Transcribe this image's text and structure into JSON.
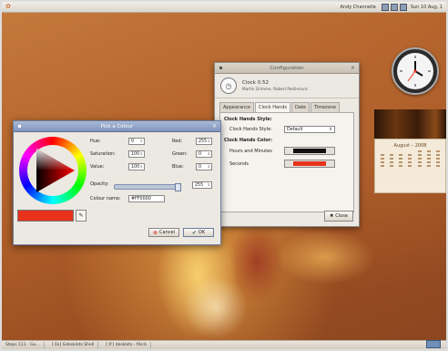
{
  "topbar": {
    "user": "Andy Channelle",
    "time": "Sun 10 Aug, 1"
  },
  "taskbar": {
    "items": [
      "Steps 111 - Gu...",
      "[ 0x] Gdesklets Shell",
      "[ 0'] desklets - file:b"
    ]
  },
  "config": {
    "title": "Configuration",
    "app_name": "Clock 0.52",
    "authors": "Martin Grimme, Robert Pastierovic",
    "tabs": [
      "Appearance",
      "Clock Hands",
      "Date",
      "Timezone"
    ],
    "style_header": "Clock Hands Style:",
    "style_label": "Clock Hands Style:",
    "style_value": "Default",
    "color_header": "Clock Hands Color:",
    "hm_label": "Hours and Minutes",
    "seconds_label": "Seconds",
    "close_label": "Close",
    "hm_color": "#111111",
    "sec_color": "#e8321c"
  },
  "pick": {
    "title": "Pick a Colour",
    "hue_label": "Hue:",
    "hue": "0",
    "sat_label": "Saturation:",
    "sat": "100",
    "val_label": "Value:",
    "val": "100",
    "red_label": "Red:",
    "red": "255",
    "green_label": "Green:",
    "green": "0",
    "blue_label": "Blue:",
    "blue": "0",
    "opacity_label": "Opacity:",
    "opacity": "255",
    "name_label": "Colour name:",
    "name": "#FF0000",
    "cancel": "Cancel",
    "ok": "OK",
    "swatch_color": "#e8321c"
  },
  "calendar": {
    "month": "August – 2008"
  }
}
